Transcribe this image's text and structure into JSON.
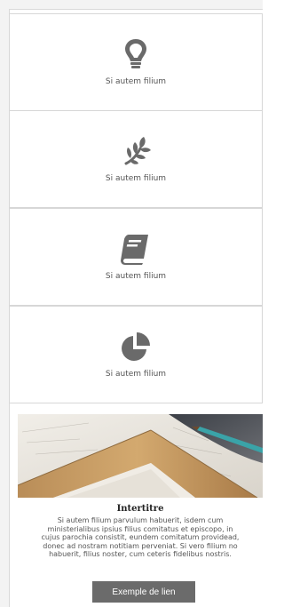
{
  "tiles": [
    {
      "label": "Si autem filium",
      "icon": "lightbulb-icon"
    },
    {
      "label": "Si autem filium",
      "icon": "leaf-sprig-icon"
    },
    {
      "label": "Si autem filium",
      "icon": "book-icon"
    },
    {
      "label": "Si autem filium",
      "icon": "pie-chart-icon"
    }
  ],
  "article": {
    "title": "Intertitre",
    "body_lines": [
      "Si autem filium parvulum habuerit, isdem cum",
      "ministerialibus ipsius filius comitatus et episcopo, in",
      "cujus parochia consistit, eundem comitatum providead,",
      "donec ad nostram notitiam perveniat. Si vero filium no",
      "habuerit, filius noster, cum ceteris fidelibus nostris."
    ],
    "button_label": "Exemple de lien"
  },
  "colors": {
    "icon": "#6a6a6a",
    "tile_border": "#d7d7d7",
    "button_bg": "#6b6b6b"
  }
}
